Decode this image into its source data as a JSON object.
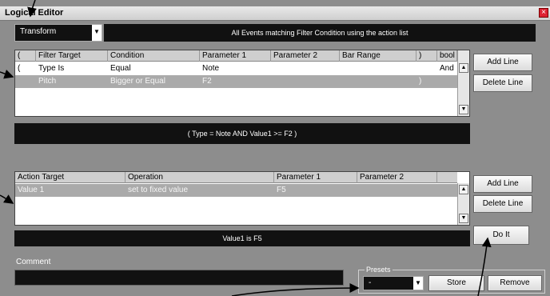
{
  "window": {
    "title": "Logical Editor"
  },
  "mode_select": {
    "value": "Transform"
  },
  "description": "All Events matching Filter Condition using the action list",
  "filter_table": {
    "headers": [
      "(",
      "Filter Target",
      "Condition",
      "Parameter 1",
      "Parameter 2",
      "Bar Range",
      ")",
      "bool"
    ],
    "rows": [
      [
        "(",
        "Type Is",
        "Equal",
        "Note",
        "",
        "",
        "",
        "And"
      ],
      [
        "",
        "Pitch",
        "Bigger or Equal",
        "F2",
        "",
        "",
        ")",
        ""
      ]
    ]
  },
  "filter_buttons": {
    "add": "Add Line",
    "delete": "Delete Line"
  },
  "condition_expr": "( Type = Note AND Value1 >= F2 )",
  "action_table": {
    "headers": [
      "Action Target",
      "Operation",
      "Parameter 1",
      "Parameter 2"
    ],
    "rows": [
      [
        "Value 1",
        "set to fixed value",
        "F5",
        ""
      ]
    ]
  },
  "action_buttons": {
    "add": "Add Line",
    "delete": "Delete Line"
  },
  "action_summary": "Value1 is F5",
  "do_it": "Do It",
  "comment": {
    "label": "Comment",
    "value": ""
  },
  "presets": {
    "label": "Presets",
    "value": "-",
    "store": "Store",
    "remove": "Remove"
  }
}
